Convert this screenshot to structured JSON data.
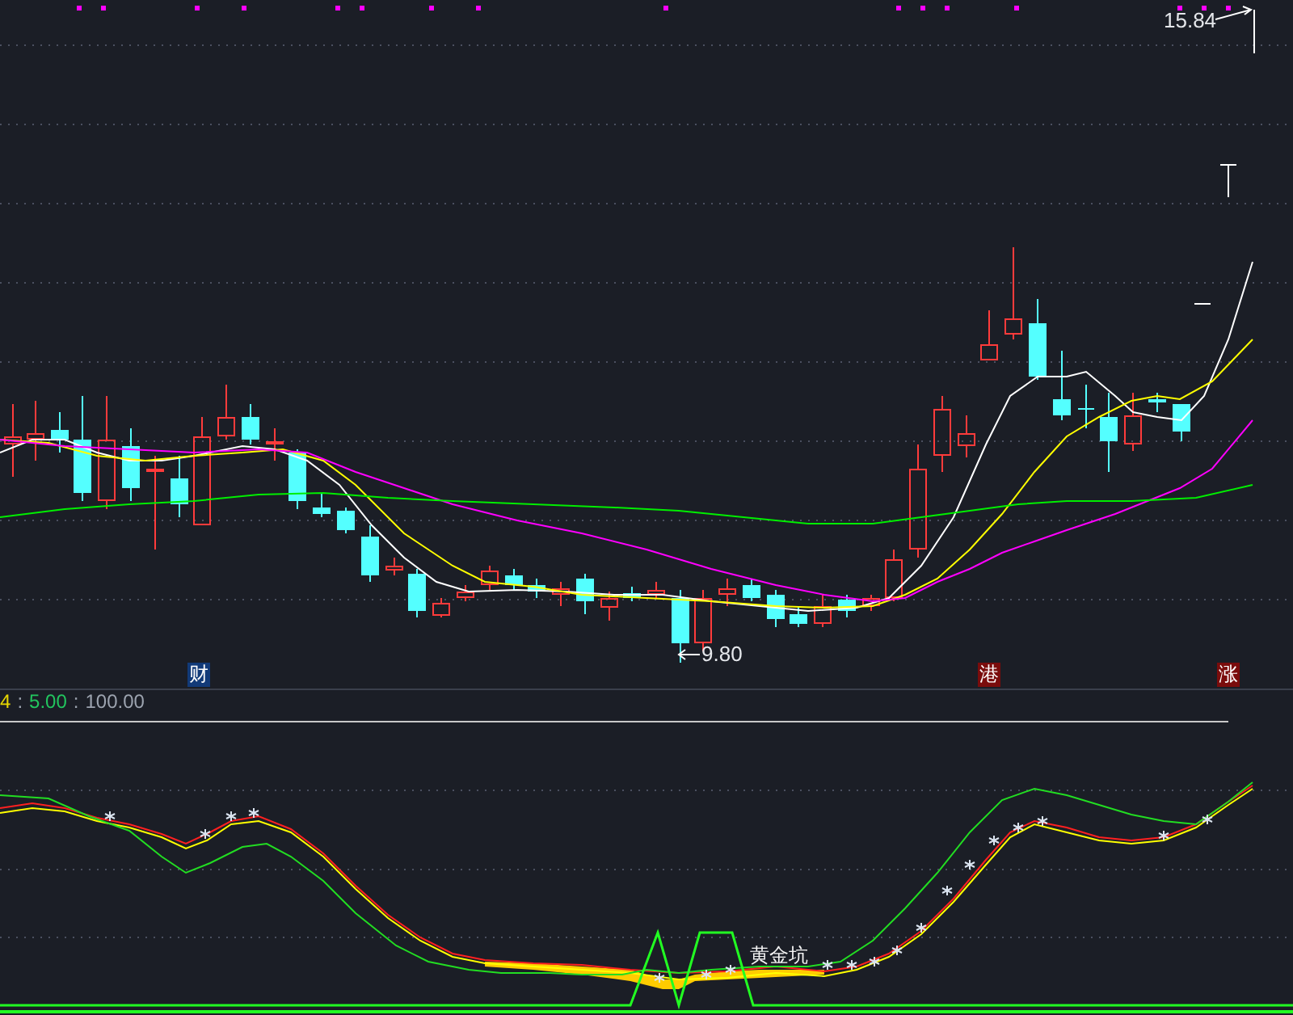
{
  "price_chart": {
    "high_label": "15.84",
    "low_label": "9.80",
    "event_markers": [
      {
        "text": "财",
        "color": "#123a78"
      },
      {
        "text": "港",
        "color": "#7a0c0c"
      },
      {
        "text": "涨",
        "color": "#7a0c0c"
      }
    ]
  },
  "indicator": {
    "header": [
      {
        "text": "4",
        "color": "#e6d600"
      },
      {
        "text": ":",
        "color": "#9ca3af"
      },
      {
        "text": "5.00",
        "color": "#22c55e"
      },
      {
        "text": ":",
        "color": "#9ca3af"
      },
      {
        "text": "100.00",
        "color": "#9ca3af"
      }
    ],
    "zone_label": "黄金坑"
  }
}
